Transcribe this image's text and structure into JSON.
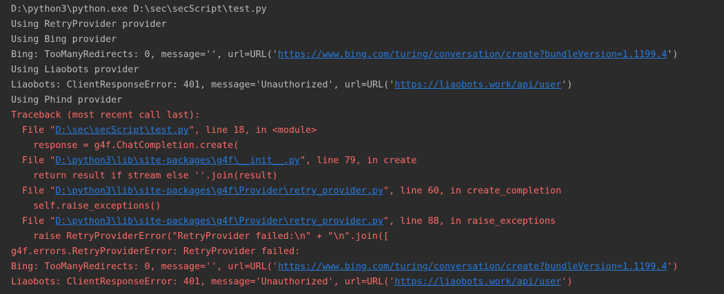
{
  "console": {
    "cmd": "D:\\python3\\python.exe D:\\sec\\secScript\\test.py",
    "using_retry": "Using RetryProvider provider",
    "using_bing": "Using Bing provider",
    "bing1_pre": "Bing: TooManyRedirects: 0, message='', url=URL('",
    "bing1_link": "https://www.bing.com/turing/conversation/create?bundleVersion=1.1199.4",
    "bing1_post": "')",
    "using_liaobots": "Using Liaobots provider",
    "liao1_pre": "Liaobots: ClientResponseError: 401, message='Unauthorized', url=URL('",
    "liao1_link": "https://liaobots.work/api/user",
    "liao1_post": "')",
    "using_phind": "Using Phind provider",
    "traceback": "Traceback (most recent call last):",
    "f1_pre": "File \"",
    "f1_link": "D:\\sec\\secScript\\test.py",
    "f1_post": "\", line 18, in <module>",
    "f1_code": "response = g4f.ChatCompletion.create(",
    "f2_pre": "File \"",
    "f2_link": "D:\\python3\\lib\\site-packages\\g4f\\__init__.py",
    "f2_post": "\", line 79, in create",
    "f2_code": "return result if stream else ''.join(result)",
    "f3_pre": "File \"",
    "f3_link": "D:\\python3\\lib\\site-packages\\g4f\\Provider\\retry_provider.py",
    "f3_post": "\", line 60, in create_completion",
    "f3_code": "self.raise_exceptions()",
    "f4_pre": "File \"",
    "f4_link": "D:\\python3\\lib\\site-packages\\g4f\\Provider\\retry_provider.py",
    "f4_post": "\", line 88, in raise_exceptions",
    "f4_code": "raise RetryProviderError(\"RetryProvider failed:\\n\" + \"\\n\".join([",
    "error_line": "g4f.errors.RetryProviderError: RetryProvider failed:",
    "bing2_pre": "Bing: TooManyRedirects: 0, message='', url=URL('",
    "bing2_link": "https://www.bing.com/turing/conversation/create?bundleVersion=1.1199.4",
    "bing2_post": "')",
    "liao2_pre": "Liaobots: ClientResponseError: 401, message='Unauthorized', url=URL('",
    "liao2_link": "https://liaobots.work/api/user",
    "liao2_post": "')"
  },
  "colors": {
    "background": "#2b2b2b",
    "stdout": "#bbbbbb",
    "stderr": "#ff6b68",
    "link": "#287bde"
  }
}
